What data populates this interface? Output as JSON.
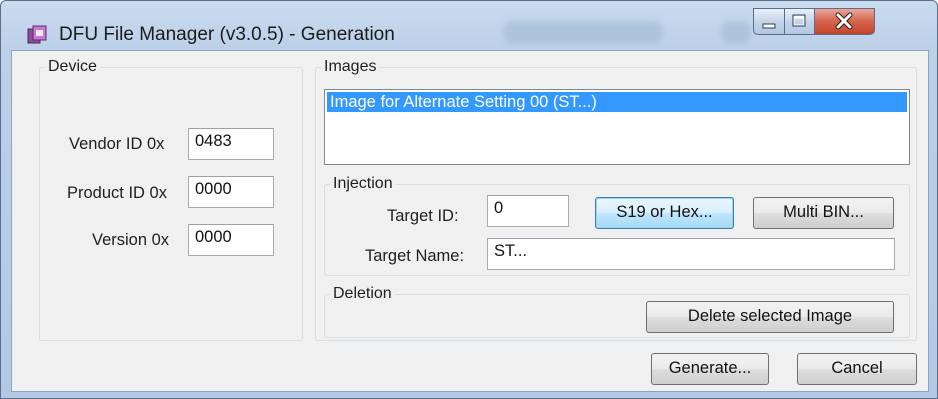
{
  "window": {
    "title": "DFU File Manager (v3.0.5) - Generation",
    "controls": {
      "minimize": "minimize-icon",
      "maximize": "maximize-icon",
      "close": "close-icon"
    }
  },
  "device": {
    "legend": "Device",
    "vendor_label": "Vendor ID 0x",
    "vendor_value": "0483",
    "product_label": "Product ID 0x",
    "product_value": "0000",
    "version_label": "Version 0x",
    "version_value": "0000"
  },
  "images": {
    "legend": "Images",
    "items": [
      "Image for Alternate Setting 00  (ST...)"
    ],
    "selected_index": 0,
    "selection_color": "#3399ff"
  },
  "injection": {
    "legend": "Injection",
    "target_id_label": "Target ID:",
    "target_id_value": "0",
    "s19_button": "S19 or Hex...",
    "multibin_button": "Multi BIN...",
    "target_name_label": "Target Name:",
    "target_name_value": "ST..."
  },
  "deletion": {
    "legend": "Deletion",
    "delete_button": "Delete selected Image"
  },
  "footer": {
    "generate_button": "Generate...",
    "cancel_button": "Cancel"
  }
}
